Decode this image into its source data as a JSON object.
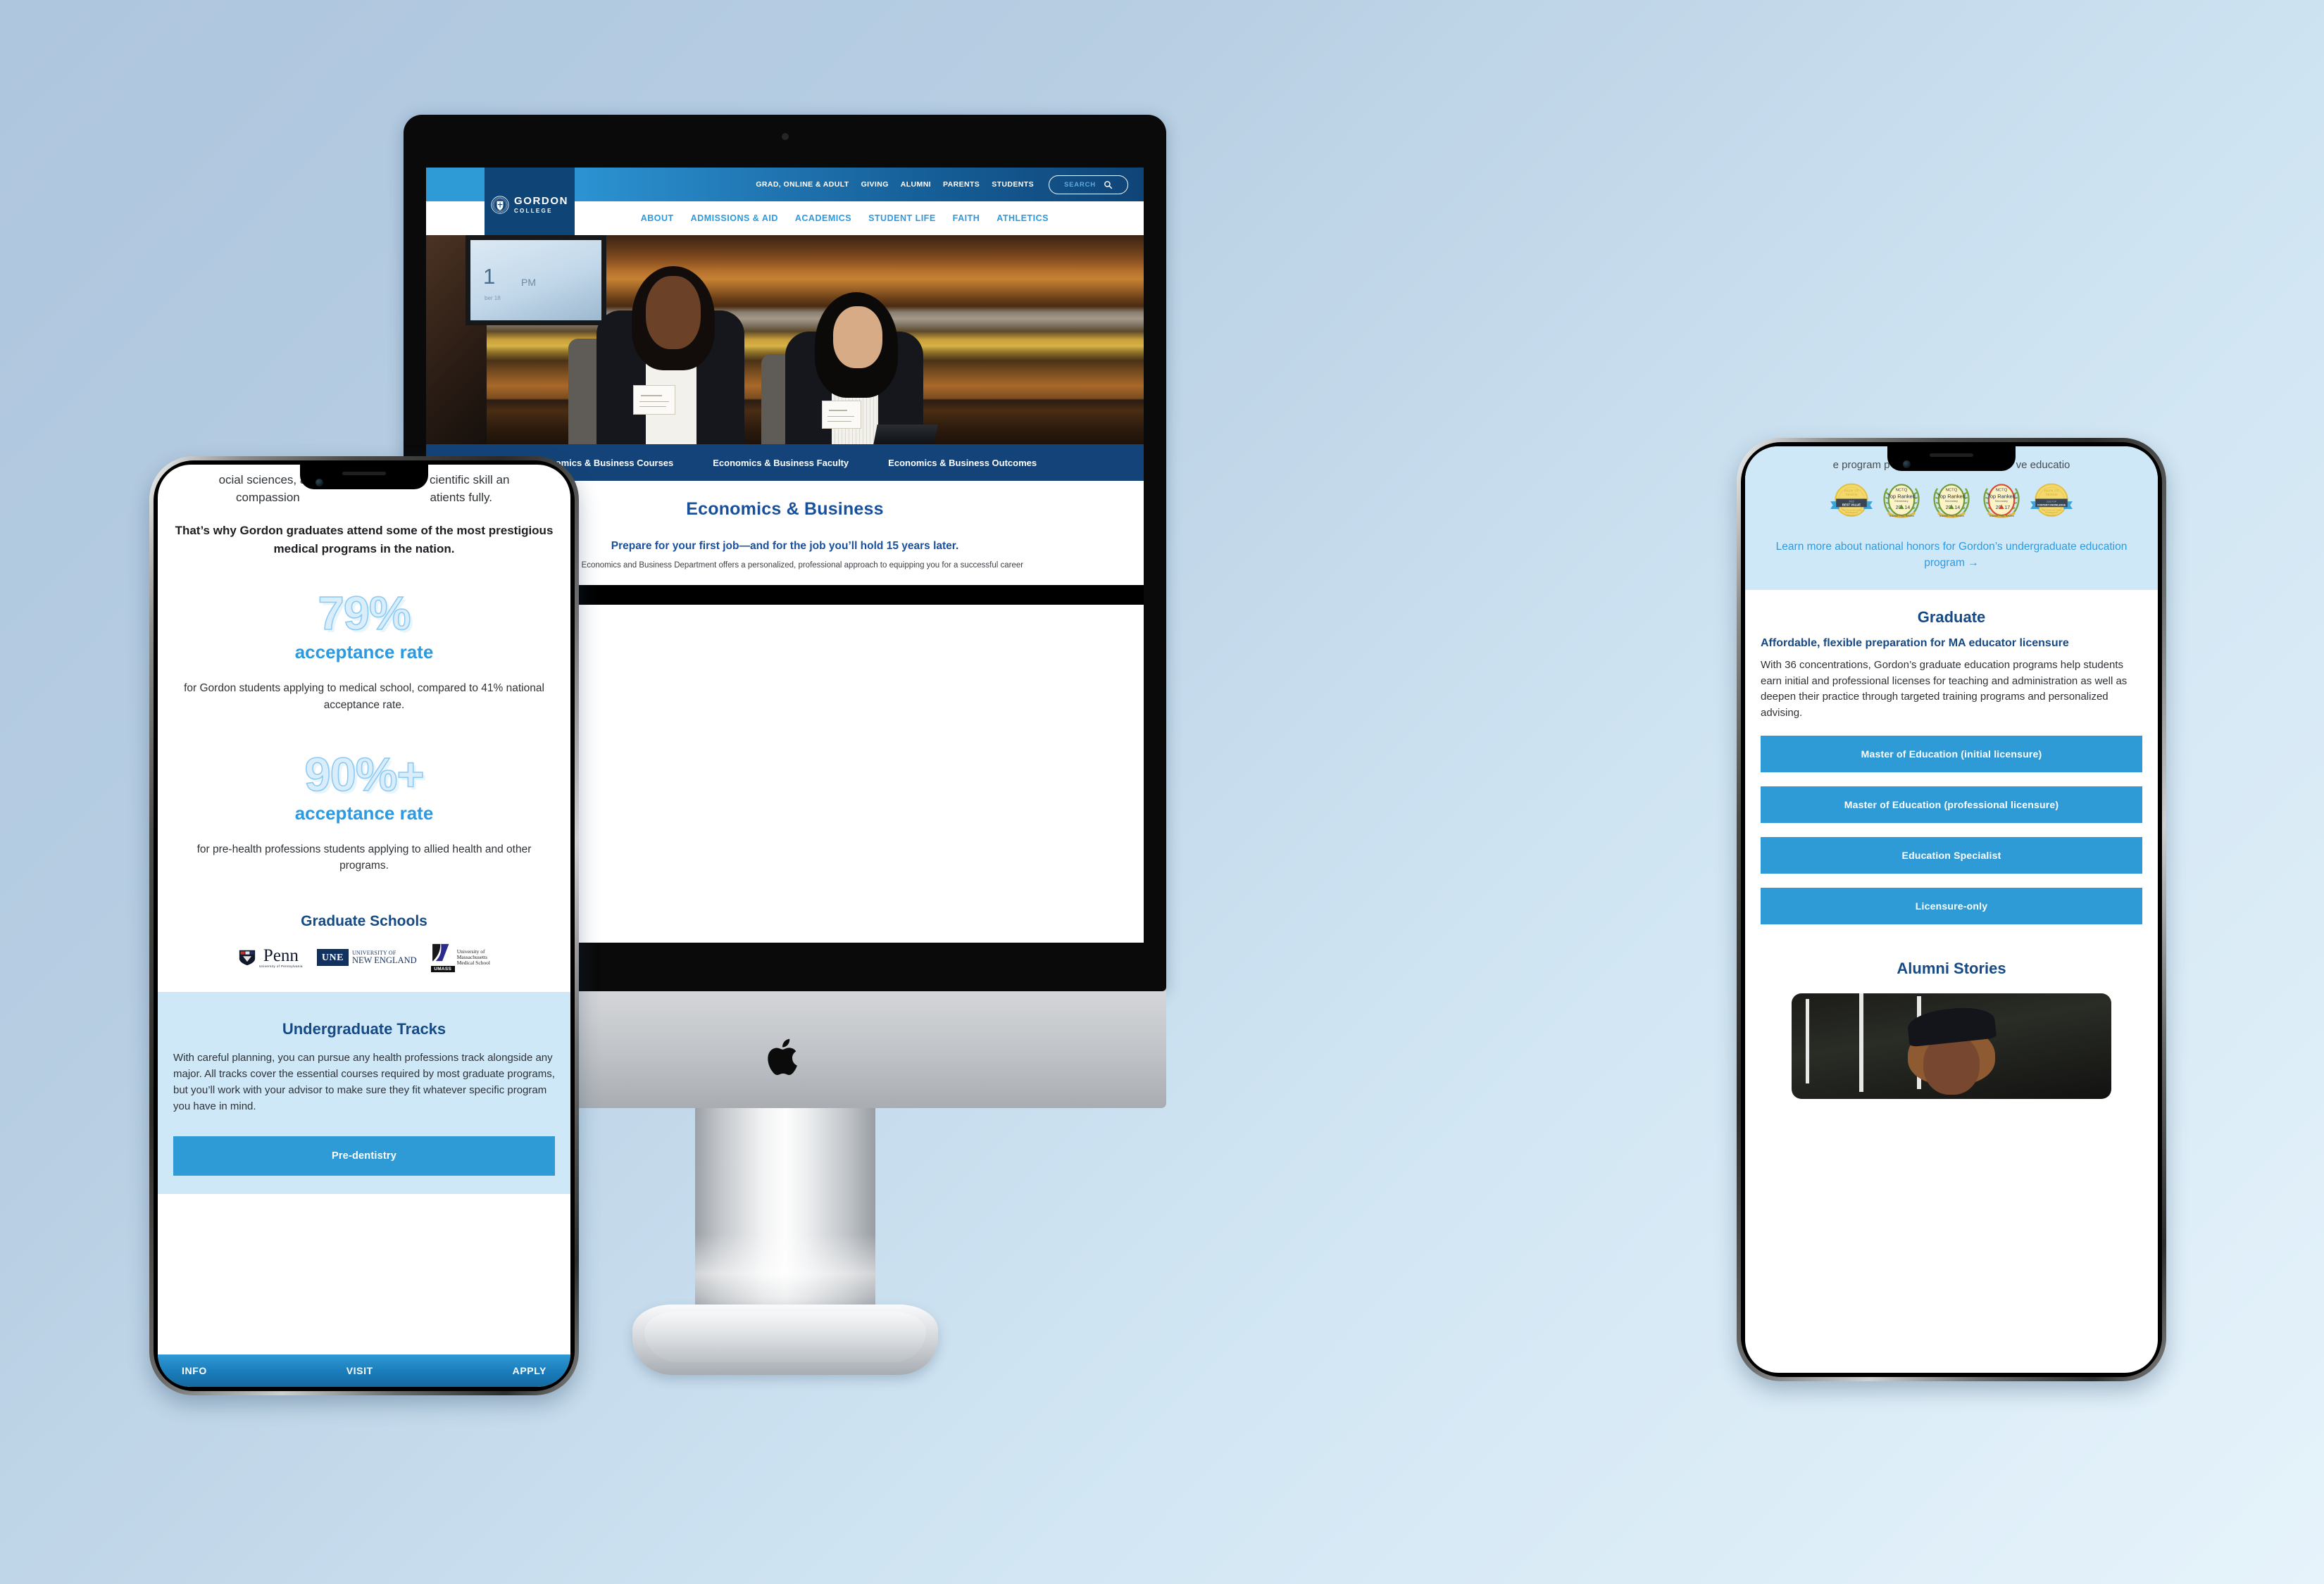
{
  "desktop": {
    "topbar": {
      "util_links": [
        "GRAD, ONLINE & ADULT",
        "GIVING",
        "ALUMNI",
        "PARENTS",
        "STUDENTS"
      ],
      "search_label": "SEARCH",
      "search_icon": "magnifier-icon"
    },
    "logo": {
      "seal_icon": "gordon-seal-icon",
      "name": "GORDON",
      "sub": "COLLEGE"
    },
    "mainnav": [
      "ABOUT",
      "ADMISSIONS & AID",
      "ACADEMICS",
      "STUDENT LIFE",
      "FAITH",
      "ATHLETICS"
    ],
    "hero": {
      "tv_time": "1",
      "tv_meridiem": "PM",
      "tv_sub": "ber 18"
    },
    "subnav": [
      "Economics & Business Courses",
      "Economics & Business Faculty",
      "Economics & Business Outcomes"
    ],
    "page": {
      "title": "Economics & Business",
      "tagline": "Prepare for your first job—and for the job you’ll hold 15 years later.",
      "intro": "Gordon’s Economics and Business Department offers a personalized, professional approach to equipping you for a successful career"
    }
  },
  "phone_left": {
    "faded_line1": "ocial sciences, a",
    "faded_line1b": "cientific skill an",
    "faded_line2": "compassion",
    "faded_line2b": "atients fully.",
    "headline": "That’s why Gordon graduates attend some of the most prestigious medical programs in the nation.",
    "stats": [
      {
        "number": "79%",
        "label": "acceptance rate",
        "note": "for Gordon students applying to medical school, compared to 41% national acceptance rate."
      },
      {
        "number": "90%+",
        "label": "acceptance rate",
        "note": "for pre-health professions students applying to allied health and other programs."
      }
    ],
    "grad_schools_title": "Graduate Schools",
    "grad_school_logos": [
      {
        "name": "Penn",
        "sub": "University of Pennsylvania"
      },
      {
        "name": "UNE",
        "line1": "UNIVERSITY OF",
        "line2": "NEW ENGLAND"
      },
      {
        "name": "UMASS",
        "line1": "University of",
        "line2": "Massachusetts",
        "line3": "Medical School",
        "bar": "UMASS"
      }
    ],
    "tracks": {
      "title": "Undergraduate Tracks",
      "body": "With careful planning, you can pursue any health professions track alongside any major. All tracks cover the essential courses required by most graduate programs, but you’ll work with your advisor to make sure they fit whatever specific program you have in mind.",
      "button": "Pre-dentistry"
    },
    "bottom_bar": [
      "INFO",
      "VISIT",
      "APPLY"
    ]
  },
  "phone_right": {
    "clipped_top": "e program p",
    "clipped_top_right": "ve educatio",
    "badges": [
      {
        "name": "path-to-teach-best-value-badge",
        "top": "PATH T® TEACH",
        "year": "2015",
        "label": "BEST VALUE",
        "note": "“The Consumer Guide to Colleges of Education”"
      },
      {
        "name": "nctq-top-ranked-elementary-2014-badge",
        "org": "NCTQ",
        "title": "Top Ranked",
        "level": "Elementary",
        "year": "20 14",
        "source": "Teacher Prep Review"
      },
      {
        "name": "nctq-top-ranked-secondary-2014-badge",
        "org": "NCTQ",
        "title": "Top Ranked",
        "level": "Secondary",
        "year": "20 14",
        "source": "Teacher Prep Review"
      },
      {
        "name": "nctq-top-ranked-secondary-2017-badge",
        "org": "NCTQ",
        "title": "Top Ranked",
        "level": "Secondary",
        "year": "20 17",
        "source": "Teacher Prep Review"
      },
      {
        "name": "path-to-teach-content-knowledge-badge",
        "top": "PATH T® TEACH",
        "year": "2015 TOP",
        "label": "CONTENT KNOWLEDGE",
        "note": "“The Consumer Guide to Colleges of Education”"
      }
    ],
    "honors_link": "Learn more about national honors for Gordon’s undergraduate education program →",
    "graduate": {
      "title": "Graduate",
      "subtitle": "Affordable, flexible preparation for MA educator licensure",
      "body": "With 36 concentrations, Gordon’s graduate education programs help students earn initial and professional licenses for teaching and administration as well as deepen their practice through targeted training programs and personalized advising."
    },
    "program_buttons": [
      "Master of Education (initial licensure)",
      "Master of Education (professional licensure)",
      "Education Specialist",
      "Licensure-only"
    ],
    "alumni_title": "Alumni Stories"
  },
  "colors": {
    "brand_navy": "#0f4477",
    "brand_heading_navy": "#164a84",
    "brand_blue": "#2e9ad6",
    "brand_link_blue": "#2b9ae0",
    "subnav_navy": "#134378",
    "pale_blue_panel": "#cfe8f8",
    "page_background_start": "#aec6de",
    "page_background_end": "#e6f3fb"
  }
}
